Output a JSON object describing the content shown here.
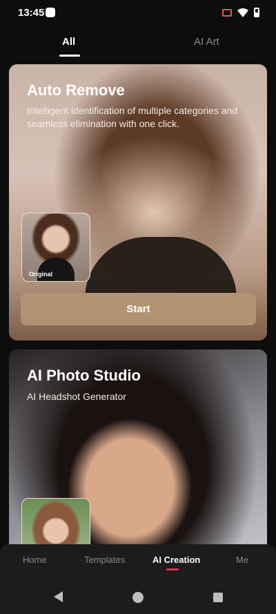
{
  "status_bar": {
    "time": "13:45"
  },
  "top_tabs": [
    {
      "label": "All",
      "active": true
    },
    {
      "label": "AI Art",
      "active": false
    }
  ],
  "cards": [
    {
      "title": "Auto Remove",
      "description": "Intelligent identification of multiple categories and seamless elimination with one click.",
      "thumbnail_label": "Original",
      "button_label": "Start"
    },
    {
      "title": "AI Photo Studio",
      "description": "AI Headshot Generator"
    }
  ],
  "bottom_nav": [
    {
      "label": "Home",
      "active": false
    },
    {
      "label": "Templates",
      "active": false
    },
    {
      "label": "AI Creation",
      "active": true
    },
    {
      "label": "Me",
      "active": false
    }
  ],
  "colors": {
    "accent_button": "#b29273",
    "active_indicator": "#e0354f",
    "background": "#0d0d0d"
  },
  "icons": [
    "app-notification-icon",
    "cast-icon",
    "wifi-icon",
    "battery-icon",
    "back-icon",
    "home-icon",
    "recents-icon"
  ]
}
